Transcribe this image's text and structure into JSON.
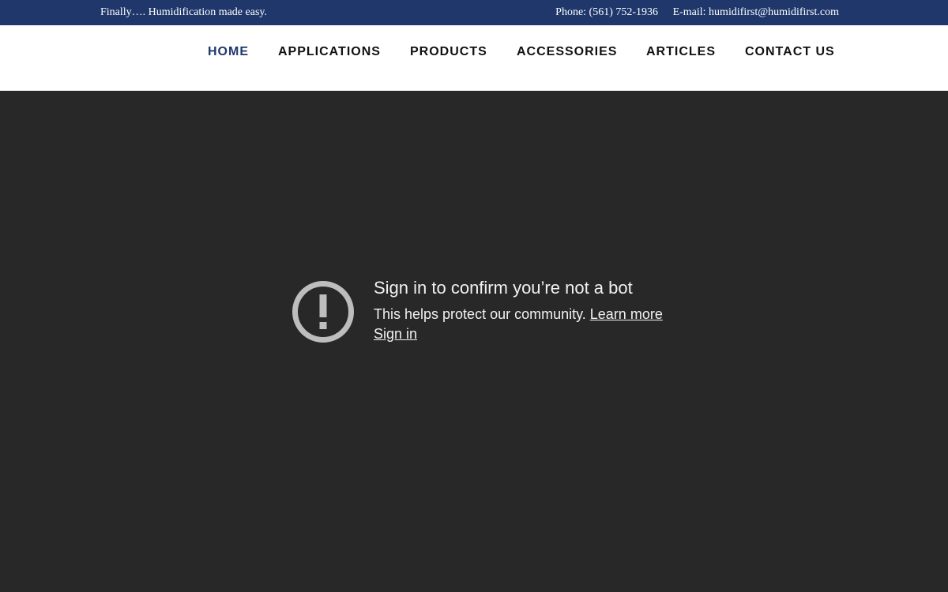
{
  "topbar": {
    "tagline": "Finally…. Humidification made easy.",
    "phone": "Phone: (561) 752-1936",
    "email": "E-mail: humidifirst@humidifirst.com",
    "background_color": "#1f376b"
  },
  "nav": {
    "items": [
      {
        "label": "HOME",
        "active": true
      },
      {
        "label": "APPLICATIONS"
      },
      {
        "label": "PRODUCTS"
      },
      {
        "label": "ACCESSORIES"
      },
      {
        "label": "ARTICLES"
      },
      {
        "label": "CONTACT US"
      }
    ],
    "active_color": "#1f376b"
  },
  "video_embed": {
    "icon": "alert-circle-icon",
    "title": "Sign in to confirm you’re not a bot",
    "message": "This helps protect our community. ",
    "learn_more": "Learn more",
    "sign_in": "Sign in",
    "background_color": "#282828"
  }
}
